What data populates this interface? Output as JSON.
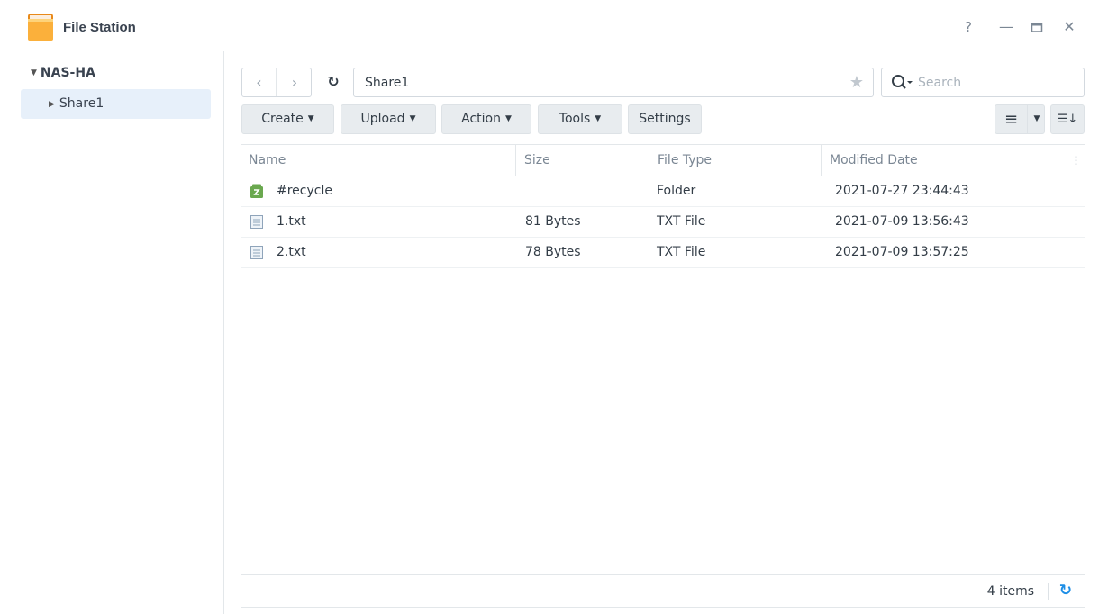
{
  "window": {
    "title": "File Station",
    "app_icon": "folder-icon",
    "controls": {
      "help": "?",
      "minimize": "—",
      "maximize": "▭",
      "close": "✕"
    }
  },
  "sidebar": {
    "root": {
      "label": "NAS-HA",
      "expanded": true
    },
    "items": [
      {
        "label": "Share1",
        "selected": true
      }
    ]
  },
  "nav": {
    "back_icon": "‹",
    "forward_icon": "›",
    "refresh_icon": "↻",
    "path": "Share1",
    "favorite_icon": "★",
    "search_placeholder": "Search",
    "search_value": ""
  },
  "toolbar": {
    "buttons": [
      {
        "label": "Create",
        "dropdown": true
      },
      {
        "label": "Upload",
        "dropdown": true
      },
      {
        "label": "Action",
        "dropdown": true
      },
      {
        "label": "Tools",
        "dropdown": true
      },
      {
        "label": "Settings",
        "dropdown": false
      }
    ],
    "view_icon": "≡",
    "sort_icon": "☰↓"
  },
  "table": {
    "columns": [
      "Name",
      "Size",
      "File Type",
      "Modified Date"
    ],
    "column_menu_icon": "⋮",
    "rows": [
      {
        "icon": "recycle-folder-icon",
        "name": "#recycle",
        "size": "",
        "type": "Folder",
        "modified": "2021-07-27 23:44:43"
      },
      {
        "icon": "text-file-icon",
        "name": "1.txt",
        "size": "81 Bytes",
        "type": "TXT File",
        "modified": "2021-07-09 13:56:43"
      },
      {
        "icon": "text-file-icon",
        "name": "2.txt",
        "size": "78 Bytes",
        "type": "TXT File",
        "modified": "2021-07-09 13:57:25"
      }
    ]
  },
  "status": {
    "item_count": "4 items",
    "refresh_icon": "↻"
  },
  "colors": {
    "accent": "#1d8ee6",
    "selection": "#e7f0fa",
    "recycle_green": "#6aa84f",
    "folder_orange": "#f5a623"
  }
}
